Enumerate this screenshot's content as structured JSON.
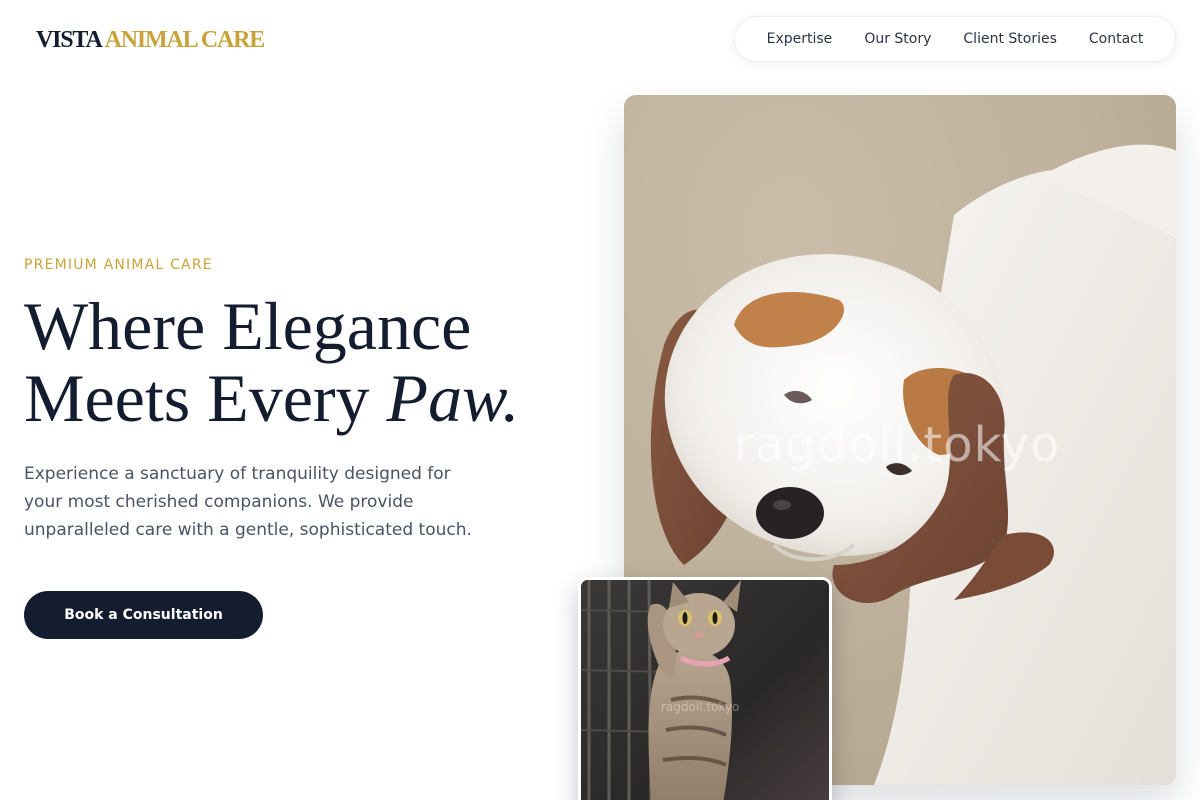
{
  "brand": {
    "name_primary": "VISTA",
    "name_accent": "ANIMAL CARE",
    "colors": {
      "navy": "#141c30",
      "gold": "#c9a43c",
      "text_muted": "#4a5266"
    }
  },
  "nav": {
    "items": [
      {
        "label": "Expertise"
      },
      {
        "label": "Our Story"
      },
      {
        "label": "Client Stories"
      },
      {
        "label": "Contact"
      }
    ]
  },
  "hero": {
    "eyebrow": "PREMIUM ANIMAL CARE",
    "headline_line1": "Where Elegance",
    "headline_line2_text": "Meets Every ",
    "headline_line2_emphasis": "Paw.",
    "lede": "Experience a sanctuary of tranquility designed for your most cherished companions. We provide unparalleled care with a gentle, sophisticated touch.",
    "cta_label": "Book a Consultation"
  },
  "images": {
    "main_watermark": "ragdoll.tokyo",
    "secondary_watermark": "ragdoll.tokyo"
  }
}
